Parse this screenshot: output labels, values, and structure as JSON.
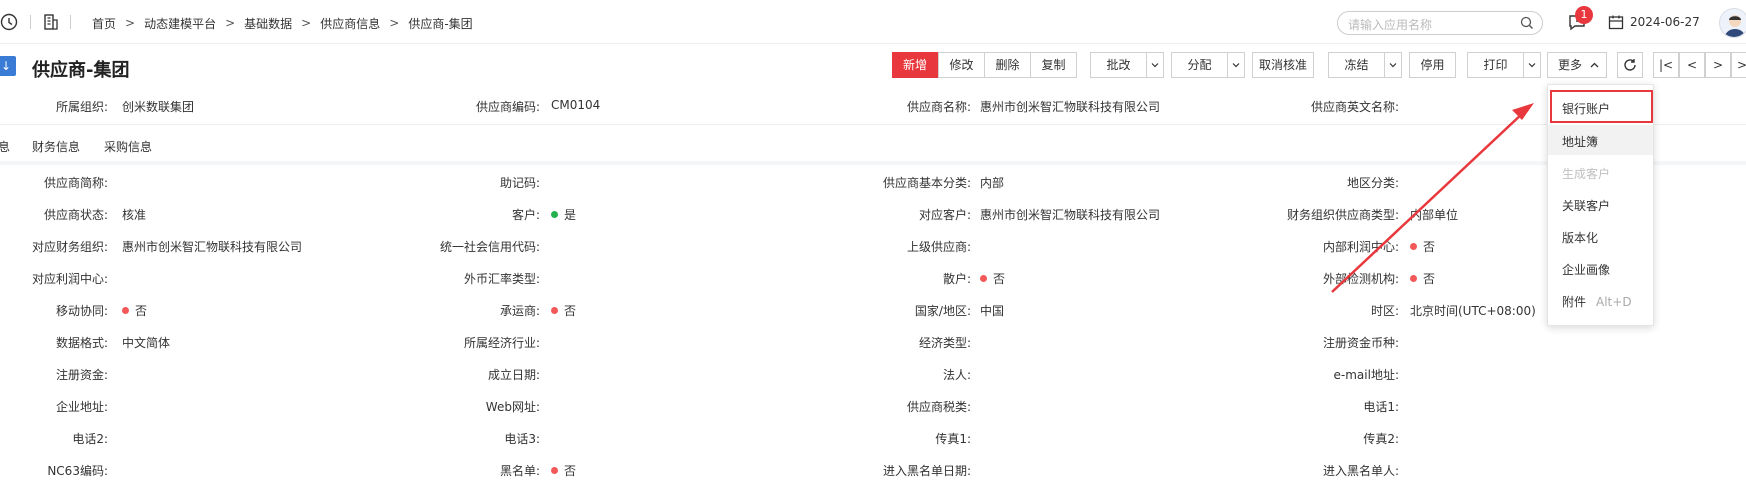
{
  "header": {
    "breadcrumbs": [
      "首页",
      "动态建模平台",
      "基础数据",
      "供应商信息",
      "供应商-集团"
    ],
    "search_placeholder": "请输入应用名称",
    "notification_count": "1",
    "date": "2024-06-27"
  },
  "title": "供应商-集团",
  "toolbar": {
    "new": "新增",
    "edit": "修改",
    "delete": "删除",
    "copy": "复制",
    "batch_edit": "批改",
    "assign": "分配",
    "cancel_approve": "取消核准",
    "freeze": "冻结",
    "disable": "停用",
    "print": "打印",
    "more": "更多"
  },
  "pager": {
    "first": "|<",
    "prev": "<",
    "next": ">",
    "last": ">|"
  },
  "head_fields": [
    {
      "label": "所属组织:",
      "value": "创米数联集团"
    },
    {
      "label": "供应商编码:",
      "value": "CM0104"
    },
    {
      "label": "供应商名称:",
      "value": "惠州市创米智汇物联科技有限公司"
    },
    {
      "label": "供应商英文名称:",
      "value": ""
    }
  ],
  "tabs": [
    "息",
    "财务信息",
    "采购信息"
  ],
  "rows": [
    [
      {
        "label": "供应商简称:",
        "value": ""
      },
      {
        "label": "助记码:",
        "value": ""
      },
      {
        "label": "供应商基本分类:",
        "value": "内部"
      },
      {
        "label": "地区分类:",
        "value": ""
      }
    ],
    [
      {
        "label": "供应商状态:",
        "value": "核准"
      },
      {
        "label": "客户:",
        "value": "是",
        "dot": "green"
      },
      {
        "label": "对应客户:",
        "value": "惠州市创米智汇物联科技有限公司"
      },
      {
        "label": "财务组织供应商类型:",
        "value": "内部单位"
      }
    ],
    [
      {
        "label": "对应财务组织:",
        "value": "惠州市创米智汇物联科技有限公司"
      },
      {
        "label": "统一社会信用代码:",
        "value": ""
      },
      {
        "label": "上级供应商:",
        "value": ""
      },
      {
        "label": "内部利润中心:",
        "value": "否",
        "dot": "red"
      }
    ],
    [
      {
        "label": "对应利润中心:",
        "value": ""
      },
      {
        "label": "外币汇率类型:",
        "value": ""
      },
      {
        "label": "散户:",
        "value": "否",
        "dot": "red"
      },
      {
        "label": "外部检测机构:",
        "value": "否",
        "dot": "red"
      }
    ],
    [
      {
        "label": "移动协同:",
        "value": "否",
        "dot": "red"
      },
      {
        "label": "承运商:",
        "value": "否",
        "dot": "red"
      },
      {
        "label": "国家/地区:",
        "value": "中国"
      },
      {
        "label": "时区:",
        "value": "北京时间(UTC+08:00)"
      }
    ],
    [
      {
        "label": "数据格式:",
        "value": "中文简体"
      },
      {
        "label": "所属经济行业:",
        "value": ""
      },
      {
        "label": "经济类型:",
        "value": ""
      },
      {
        "label": "注册资金币种:",
        "value": ""
      }
    ],
    [
      {
        "label": "注册资金:",
        "value": ""
      },
      {
        "label": "成立日期:",
        "value": ""
      },
      {
        "label": "法人:",
        "value": ""
      },
      {
        "label": "e-mail地址:",
        "value": ""
      }
    ],
    [
      {
        "label": "企业地址:",
        "value": ""
      },
      {
        "label": "Web网址:",
        "value": ""
      },
      {
        "label": "供应商税类:",
        "value": ""
      },
      {
        "label": "电话1:",
        "value": ""
      }
    ],
    [
      {
        "label": "电话2:",
        "value": ""
      },
      {
        "label": "电话3:",
        "value": ""
      },
      {
        "label": "传真1:",
        "value": ""
      },
      {
        "label": "传真2:",
        "value": ""
      }
    ],
    [
      {
        "label": "NC63编码:",
        "value": ""
      },
      {
        "label": "黑名单:",
        "value": "否",
        "dot": "red"
      },
      {
        "label": "进入黑名单日期:",
        "value": ""
      },
      {
        "label": "进入黑名单人:",
        "value": ""
      }
    ]
  ],
  "more_menu": [
    {
      "label": "银行账户"
    },
    {
      "label": "地址簿"
    },
    {
      "label": "生成客户",
      "disabled": true
    },
    {
      "label": "关联客户"
    },
    {
      "label": "版本化"
    },
    {
      "label": "企业画像"
    },
    {
      "label": "附件",
      "shortcut": "Alt+D"
    }
  ],
  "colors": {
    "accent": "#e8383d",
    "status_green": "#22b14c",
    "status_red": "#f25858"
  }
}
